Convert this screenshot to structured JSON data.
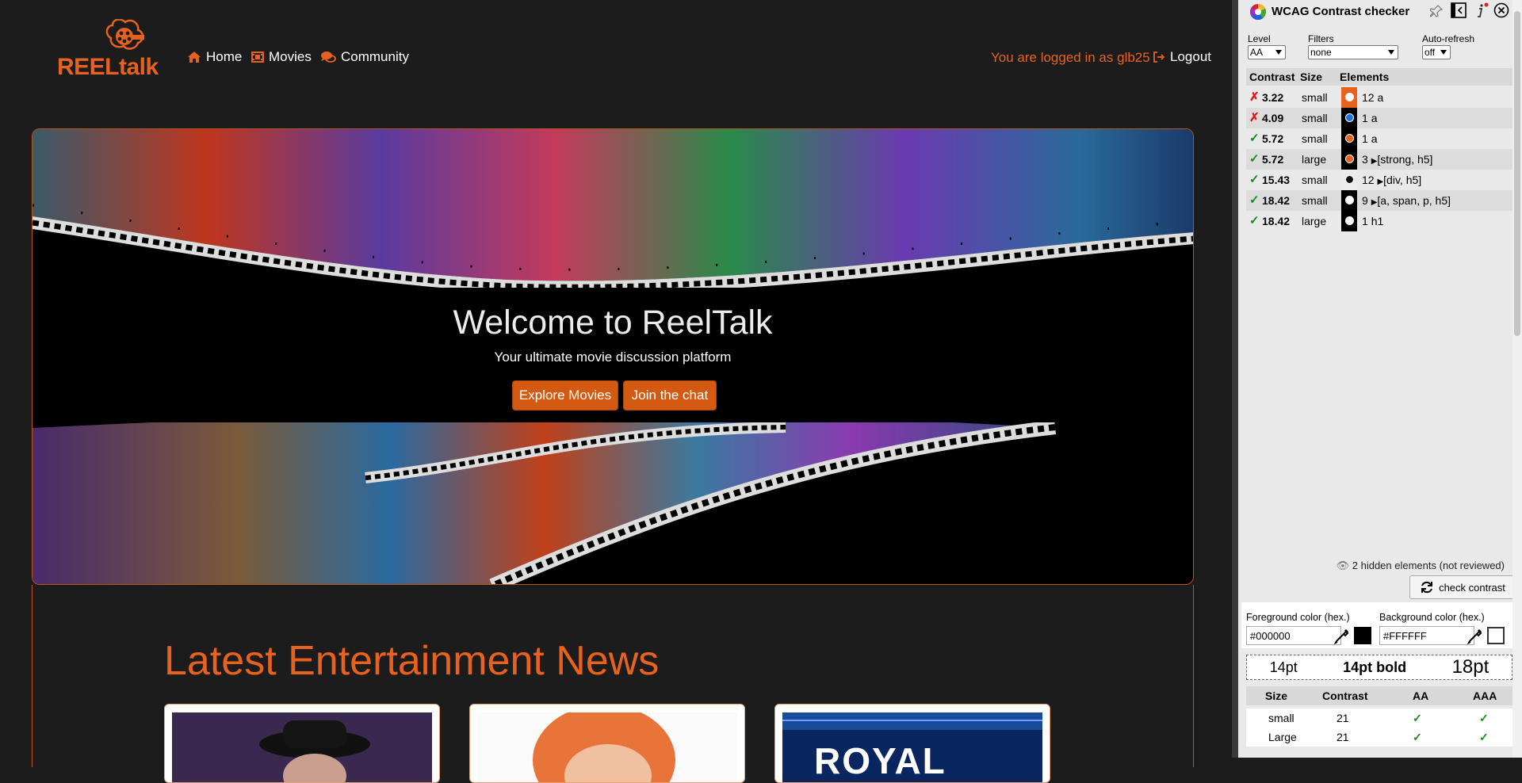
{
  "header": {
    "logo_text": "REELtalk",
    "nav": [
      {
        "label": "Home",
        "icon": "home-icon"
      },
      {
        "label": "Movies",
        "icon": "film-icon"
      },
      {
        "label": "Community",
        "icon": "comments-icon"
      }
    ],
    "login_status": "You are logged in as glb25",
    "logout_label": "Logout"
  },
  "hero": {
    "title": "Welcome to ReelTalk",
    "subtitle": "Your ultimate movie discussion platform",
    "buttons": [
      "Explore Movies",
      "Join the chat"
    ]
  },
  "news": {
    "title": "Latest Entertainment News",
    "cards": [
      {
        "image": "person-in-black-hat-photo"
      },
      {
        "image": "red-haired-singer-photo"
      },
      {
        "image": "royal-rumble-arena-photo",
        "text": "ROYAL"
      }
    ]
  },
  "colors": {
    "accent": "#e8621f",
    "background": "#1c1c1c",
    "hero_bg": "#000000",
    "button": "#d35a10"
  },
  "panel": {
    "title": "WCAG Contrast checker",
    "level_label": "Level",
    "level_value": "AA",
    "filters_label": "Filters",
    "filters_value": "none",
    "autorefresh_label": "Auto-refresh",
    "autorefresh_value": "off",
    "columns": [
      "Contrast",
      "Size",
      "Elements"
    ],
    "rows": [
      {
        "pass": false,
        "ratio": "3.22",
        "size": "small",
        "swatch": "#e8621f",
        "dot": "#ffffff",
        "count": "12",
        "elements": "a"
      },
      {
        "pass": false,
        "ratio": "4.09",
        "size": "small",
        "swatch": "#000000",
        "dot": "#1e6fe0",
        "count": "1",
        "elements": "a"
      },
      {
        "pass": true,
        "ratio": "5.72",
        "size": "small",
        "swatch": "#000000",
        "dot": "#e8621f",
        "count": "1",
        "elements": "a"
      },
      {
        "pass": true,
        "ratio": "5.72",
        "size": "large",
        "swatch": "#000000",
        "dot": "#e8621f",
        "count": "3",
        "elements": "[strong, h5]"
      },
      {
        "pass": true,
        "ratio": "15.43",
        "size": "small",
        "swatch": "#ececec",
        "dot": "#111111",
        "count": "12",
        "elements": "[div, h5]"
      },
      {
        "pass": true,
        "ratio": "18.42",
        "size": "small",
        "swatch": "#000000",
        "dot": "#ffffff",
        "count": "9",
        "elements": "[a, span, p, h5]"
      },
      {
        "pass": true,
        "ratio": "18.42",
        "size": "large",
        "swatch": "#000000",
        "dot": "#ffffff",
        "count": "1",
        "elements": "h1"
      }
    ],
    "hidden_note": "2 hidden elements (not reviewed)",
    "check_label": "check contrast",
    "fg_label": "Foreground color (hex.)",
    "fg_value": "#000000",
    "bg_label": "Background color (hex.)",
    "bg_value": "#FFFFFF",
    "size_samples": [
      "14pt",
      "14pt bold",
      "18pt"
    ],
    "result_columns": [
      "Size",
      "Contrast",
      "AA",
      "AAA"
    ],
    "results": [
      {
        "size": "small",
        "contrast": "21"
      },
      {
        "size": "Large",
        "contrast": "21"
      }
    ]
  }
}
